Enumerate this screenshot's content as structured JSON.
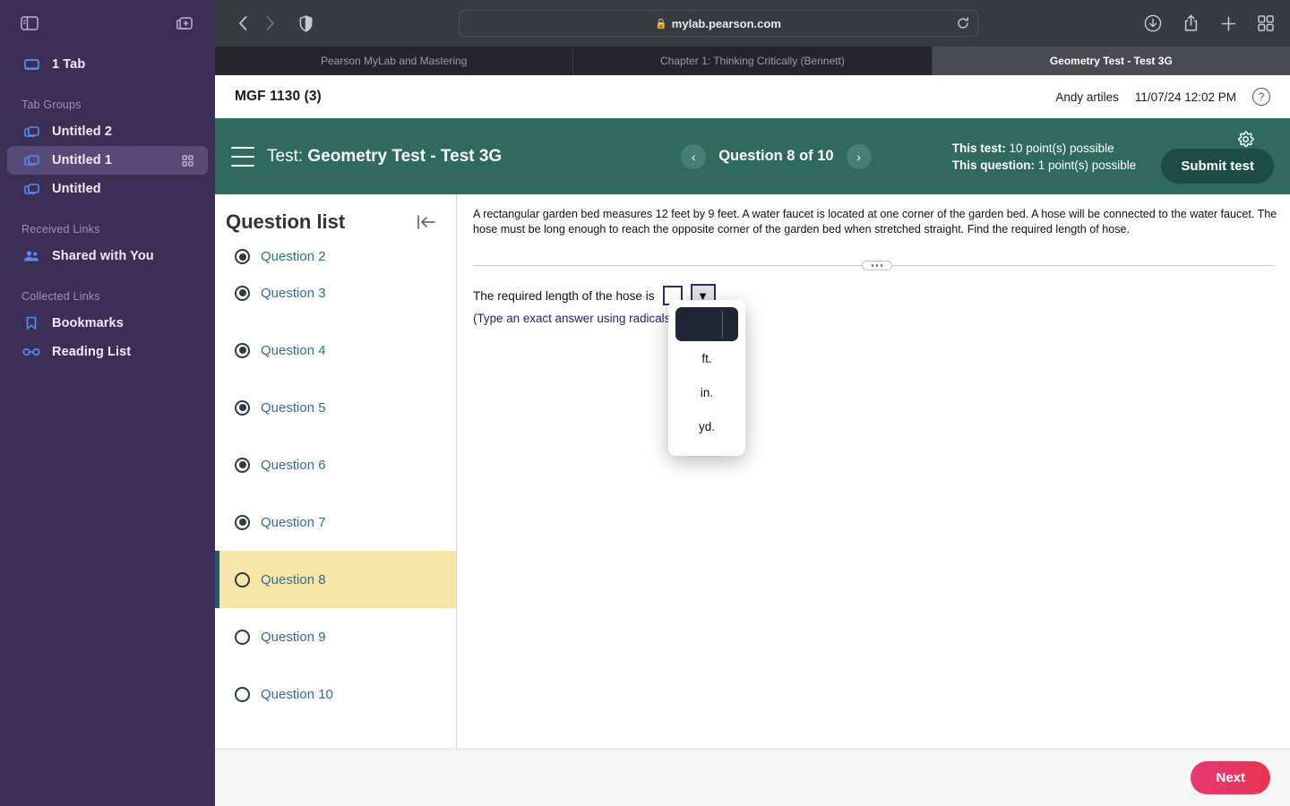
{
  "browser": {
    "sidebar": {
      "toggle_sidebar_icon": "sidebar-icon",
      "new_tab_group_icon": "new-tab-group-icon",
      "tab_count_label": "1 Tab",
      "sections": [
        {
          "heading": "Tab Groups",
          "items": [
            {
              "label": "Untitled 2",
              "active": false,
              "trailing_icon": ""
            },
            {
              "label": "Untitled 1",
              "active": true,
              "trailing_icon": "grid-icon"
            },
            {
              "label": "Untitled",
              "active": false,
              "trailing_icon": ""
            }
          ]
        },
        {
          "heading": "Received Links",
          "items": [
            {
              "label": "Shared with You",
              "active": false,
              "trailing_icon": ""
            }
          ]
        },
        {
          "heading": "Collected Links",
          "items": [
            {
              "label": "Bookmarks",
              "active": false,
              "trailing_icon": ""
            },
            {
              "label": "Reading List",
              "active": false,
              "trailing_icon": ""
            }
          ]
        }
      ]
    },
    "toolbar": {
      "back_icon": "chevron-left-icon",
      "forward_icon": "chevron-right-icon",
      "shield_icon": "privacy-shield-icon",
      "url": "mylab.pearson.com",
      "lock_icon": "lock-icon",
      "reload_icon": "reload-icon",
      "downloads_icon": "download-icon",
      "share_icon": "share-icon",
      "new_tab_icon": "plus-icon",
      "tab_overview_icon": "tab-overview-icon"
    },
    "tabs": [
      {
        "title": "Pearson MyLab and Mastering",
        "active": false
      },
      {
        "title": "Chapter 1: Thinking Critically (Bennett)",
        "active": false
      },
      {
        "title": "Geometry Test - Test 3G",
        "active": true
      }
    ]
  },
  "page": {
    "course_bar": {
      "course": "MGF 1130 (3)",
      "user": "Andy artiles",
      "datetime": "11/07/24 12:02 PM",
      "help_icon": "question-mark-icon"
    },
    "test_bar": {
      "menu_icon": "hamburger-menu-icon",
      "label_prefix": "Test: ",
      "test_name": "Geometry Test - Test 3G",
      "prev_icon": "‹",
      "next_icon": "›",
      "question_position": "Question 8 of 10",
      "points_test_label": "This test: ",
      "points_test_value": "10 point(s) possible",
      "points_question_label": "This question: ",
      "points_question_value": "1 point(s) possible",
      "settings_icon": "gear-icon",
      "submit_label": "Submit test"
    },
    "question_list": {
      "title": "Question list",
      "collapse_icon": "collapse-panel-icon",
      "items": [
        {
          "label": "Question 2",
          "state": "answered",
          "current": false,
          "clipped": true
        },
        {
          "label": "Question 3",
          "state": "answered",
          "current": false,
          "clipped": false
        },
        {
          "label": "Question 4",
          "state": "answered",
          "current": false,
          "clipped": false
        },
        {
          "label": "Question 5",
          "state": "answered",
          "current": false,
          "clipped": false
        },
        {
          "label": "Question 6",
          "state": "answered",
          "current": false,
          "clipped": false
        },
        {
          "label": "Question 7",
          "state": "answered",
          "current": false,
          "clipped": false
        },
        {
          "label": "Question 8",
          "state": "unanswered",
          "current": true,
          "clipped": false
        },
        {
          "label": "Question 9",
          "state": "unanswered",
          "current": false,
          "clipped": false
        },
        {
          "label": "Question 10",
          "state": "unanswered",
          "current": false,
          "clipped": false
        }
      ]
    },
    "question": {
      "prompt": "A rectangular garden bed measures 12 feet by 9 feet. A water faucet is located at one corner of the garden bed.  A hose will be connected to the water faucet.  The hose must be long enough to reach the opposite corner of the garden bed when stretched straight.  Find the required length of hose.",
      "answer_label": "The required length of the hose is",
      "answer_value": "",
      "unit_caret": "▼",
      "hint": "(Type an exact answer using radicals as needed.)",
      "dropdown": {
        "open": true,
        "options": [
          {
            "label": "",
            "selected": true
          },
          {
            "label": "ft.",
            "selected": false
          },
          {
            "label": "in.",
            "selected": false
          },
          {
            "label": "yd.",
            "selected": false
          }
        ]
      }
    },
    "footer": {
      "next_label": "Next"
    }
  },
  "colors": {
    "brand_green": "#2e6b5e",
    "submit_green": "#1d4c44",
    "highlight_yellow": "#f8e6a9",
    "current_marker": "#21566b",
    "link_blue": "#2e6e8e",
    "next_gradient_start": "#e63975",
    "next_gradient_end": "#e8344f",
    "sidebar_purple": "#3a3055",
    "dropdown_selected": "#1f2636"
  }
}
